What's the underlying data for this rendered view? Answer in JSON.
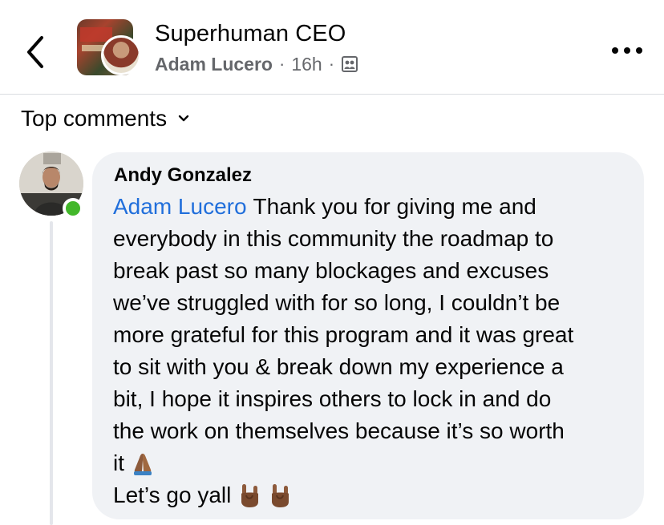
{
  "header": {
    "group_name": "Superhuman CEO",
    "author": "Adam Lucero",
    "separator": "·",
    "time": "16h",
    "privacy_icon": "group-members-icon",
    "back_icon": "chevron-left-icon",
    "more_icon": "more-dots-icon"
  },
  "sort": {
    "label": "Top comments",
    "icon": "chevron-down-icon"
  },
  "comment": {
    "author": "Andy Gonzalez",
    "online": true,
    "mention": "Adam Lucero",
    "lines": [
      "Thank you for giving me and",
      "everybody in this community the roadmap to",
      "break past so many blockages and excuses",
      "we’ve struggled with for so long, I couldn’t be",
      "more grateful for this program and it was great",
      "to sit with you & break down my experience a",
      "bit, I hope it inspires others to lock in and do",
      "the work on themselves because it’s so worth",
      "it",
      "Let’s go yall"
    ],
    "emojis": {
      "praying_hands": "praying-hands-icon",
      "sign_of_horns": "sign-of-the-horns-icon"
    }
  },
  "colors": {
    "bubble": "#f0f2f5",
    "mention": "#216fdb",
    "online": "#42b72a",
    "secondary_text": "#65676b"
  }
}
